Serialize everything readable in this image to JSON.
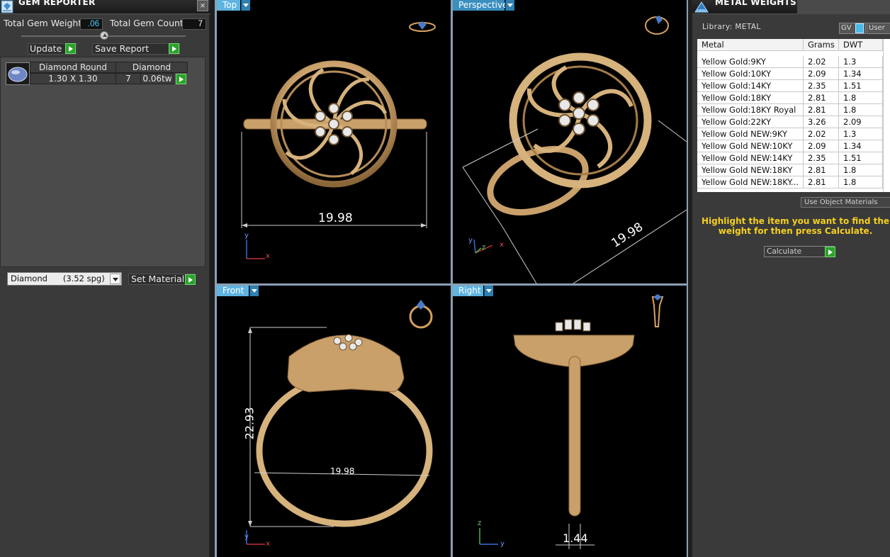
{
  "gem_reporter": {
    "title": "GEM REPORTER",
    "close_symbol": "×",
    "total_gem_weight_label": "Total Gem Weight",
    "total_gem_weight_value": ".06",
    "total_gem_count_label": "Total Gem Count",
    "total_gem_count_value": "7",
    "update_label": "Update",
    "save_report_label": "Save Report",
    "gem_row": {
      "shape": "Diamond Round",
      "type": "Diamond",
      "size": "1.30 X 1.30",
      "count": "7",
      "weight": "0.06tw"
    },
    "material_select_value": "Diamond      (3.52 spg)",
    "set_material_label": "Set Material"
  },
  "viewports": {
    "top": {
      "label": "Top",
      "dimension": "19.98",
      "axis_y": "y",
      "axis_x": "x"
    },
    "perspective": {
      "label": "Perspective",
      "dimension": "19.98",
      "axis_y": "y",
      "axis_z": "z",
      "axis_x": "x"
    },
    "front": {
      "label": "Front",
      "height_dimension": "22.93",
      "width_dimension": "19.98",
      "axis_y": "y",
      "axis_x": "x"
    },
    "right": {
      "label": "Right",
      "dimension": "1.44",
      "axis_z": "z",
      "axis_y": "y"
    }
  },
  "metal_weights": {
    "title": "METAL WEIGHTS",
    "library_label": "Library: METAL",
    "gv_label": "GV",
    "user_label": "User",
    "columns": [
      "Metal",
      "Grams",
      "DWT"
    ],
    "rows": [
      [
        "Yellow Gold:9KY",
        "2.02",
        "1.3"
      ],
      [
        "Yellow Gold:10KY",
        "2.09",
        "1.34"
      ],
      [
        "Yellow Gold:14KY",
        "2.35",
        "1.51"
      ],
      [
        "Yellow Gold:18KY",
        "2.81",
        "1.8"
      ],
      [
        "Yellow Gold:18KY Royal",
        "2.81",
        "1.8"
      ],
      [
        "Yellow Gold:22KY",
        "3.26",
        "2.09"
      ],
      [
        "Yellow Gold NEW:9KY",
        "2.02",
        "1.3"
      ],
      [
        "Yellow Gold NEW:10KY",
        "2.09",
        "1.34"
      ],
      [
        "Yellow Gold NEW:14KY",
        "2.35",
        "1.51"
      ],
      [
        "Yellow Gold NEW:18KY",
        "2.81",
        "1.8"
      ],
      [
        "Yellow Gold NEW:18KY...",
        "2.81",
        "1.8"
      ]
    ],
    "use_object_materials_label": "Use Object Materials",
    "highlight_message": "Highlight the item you want to find the weight for then press Calculate.",
    "calculate_label": "Calculate"
  },
  "colors": {
    "accent_blue": "#5fb4e0",
    "gold": "#d6b27c",
    "go_green": "#2aa32a",
    "highlight_yellow": "#f5d020"
  }
}
